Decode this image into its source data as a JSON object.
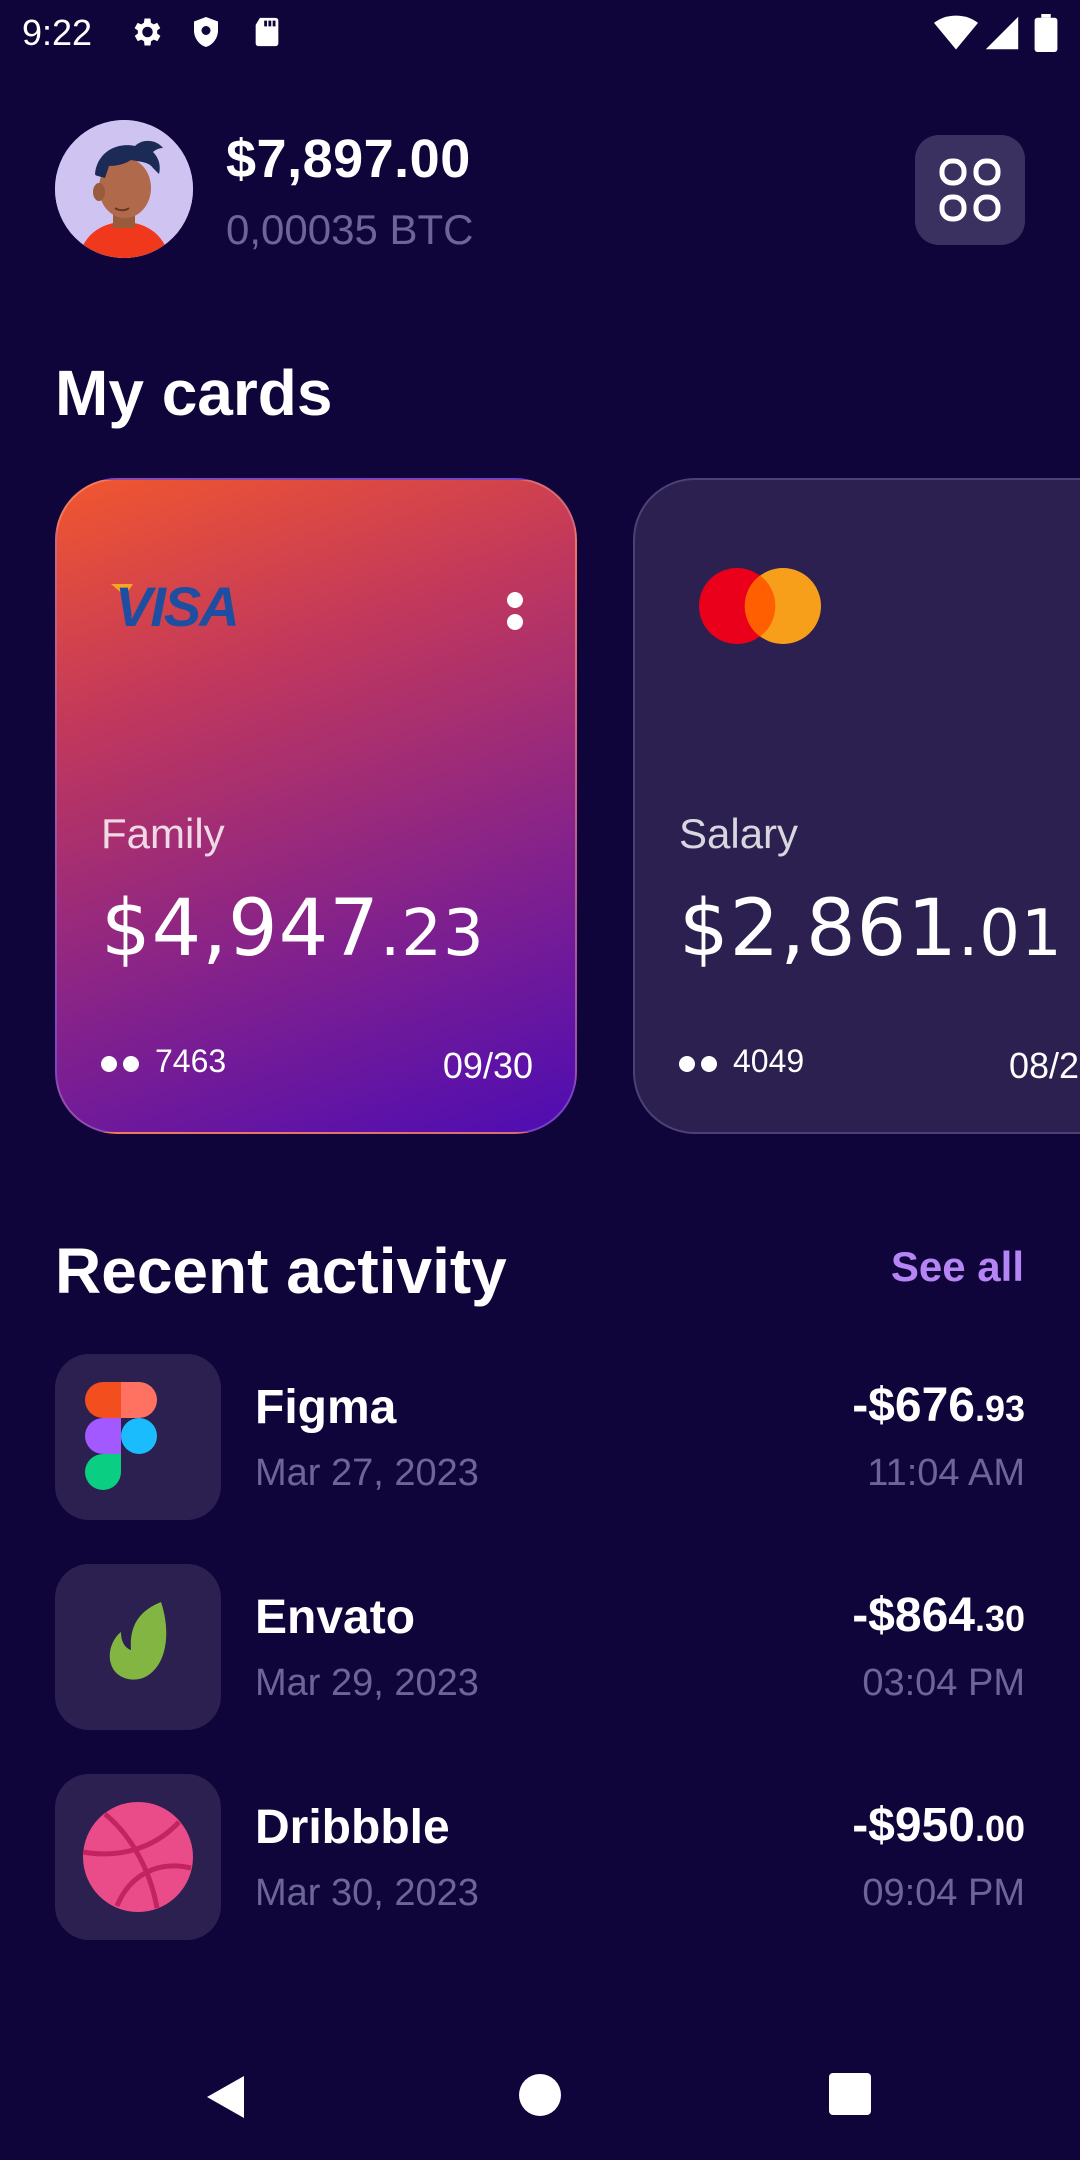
{
  "status_bar": {
    "time": "9:22"
  },
  "header": {
    "balance": "$7,897.00",
    "btc": "0,00035 BTC"
  },
  "cards_section": {
    "title": "My cards"
  },
  "cards": [
    {
      "brand": "VISA",
      "label": "Family",
      "amount_main": "$4,947",
      "amount_cents": ".23",
      "last4": "7463",
      "expiry": "09/30"
    },
    {
      "brand": "mastercard",
      "label": "Salary",
      "amount_main": "$2,861",
      "amount_cents": ".01",
      "last4": "4049",
      "expiry": "08/2"
    }
  ],
  "activity_section": {
    "title": "Recent activity",
    "see_all": "See all"
  },
  "activity": [
    {
      "name": "Figma",
      "date": "Mar 27, 2023",
      "amount_main": "-$676",
      "amount_cents": ".93",
      "time": "11:04 AM",
      "icon": "figma-icon"
    },
    {
      "name": "Envato",
      "date": "Mar 29, 2023",
      "amount_main": "-$864",
      "amount_cents": ".30",
      "time": "03:04 PM",
      "icon": "envato-icon"
    },
    {
      "name": "Dribbble",
      "date": "Mar 30, 2023",
      "amount_main": "-$950",
      "amount_cents": ".00",
      "time": "09:04 PM",
      "icon": "dribbble-icon"
    }
  ],
  "colors": {
    "background": "#10053a",
    "accent": "#b685f5",
    "muted_text": "#6d6598",
    "tile": "#2b2050"
  }
}
